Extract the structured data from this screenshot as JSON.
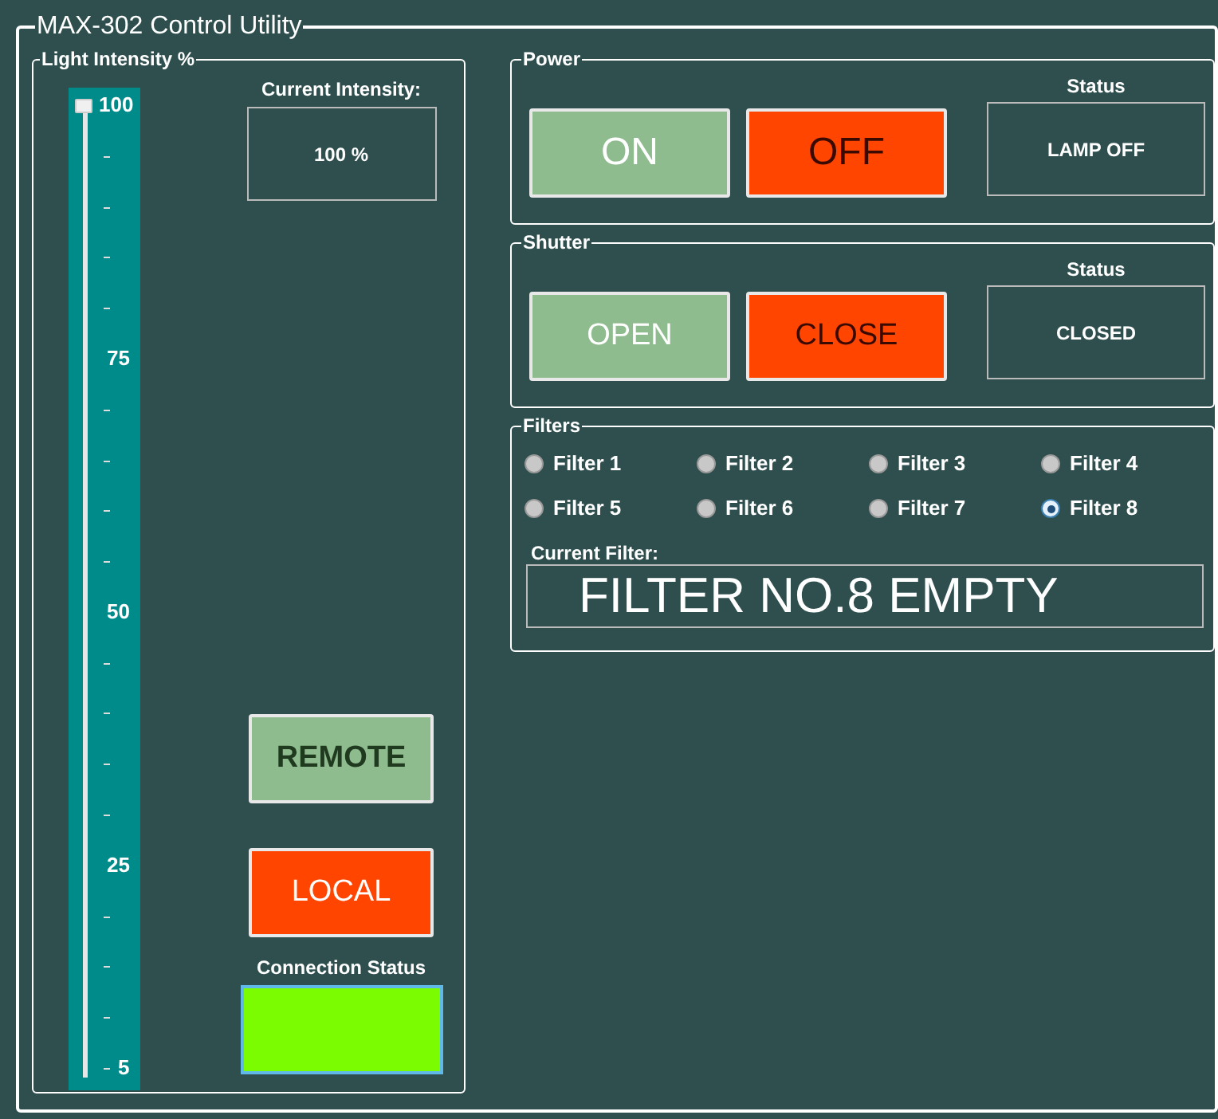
{
  "window": {
    "title": "MAX-302 Control Utility"
  },
  "intensity": {
    "title": "Light Intensity %",
    "level": 1,
    "scale_labels": [
      "100",
      "75",
      "50",
      "25",
      "5"
    ],
    "current_label": "Current Intensity:",
    "current_value": "100 %",
    "mode_buttons": [
      {
        "label": "REMOTE",
        "color": "#8fbc8f"
      },
      {
        "label": "LOCAL",
        "color": "#ff4500"
      }
    ],
    "connection": {
      "label": "Connection Status",
      "color": "#7cfc00"
    }
  },
  "power": {
    "title": "Power",
    "buttons": [
      {
        "label": "ON",
        "color": "#8fbc8f"
      },
      {
        "label": "OFF",
        "color": "#ff4500"
      }
    ],
    "status_label": "Status",
    "status": "LAMP OFF"
  },
  "shutter": {
    "title": "Shutter",
    "buttons": [
      {
        "label": "OPEN",
        "color": "#8fbc8f"
      },
      {
        "label": "CLOSE",
        "color": "#ff4500"
      }
    ],
    "status_label": "Status",
    "status": "CLOSED"
  },
  "filters": {
    "title": "Filters",
    "options": [
      {
        "label": "Filter 1",
        "selected": false
      },
      {
        "label": "Filter 2",
        "selected": false
      },
      {
        "label": "Filter 3",
        "selected": false
      },
      {
        "label": "Filter 4",
        "selected": false
      },
      {
        "label": "Filter 5",
        "selected": false
      },
      {
        "label": "Filter 6",
        "selected": false
      },
      {
        "label": "Filter 7",
        "selected": false
      },
      {
        "label": "Filter 8",
        "selected": true
      }
    ],
    "current_label": "Current Filter:",
    "current_value": "FILTER NO.8 EMPTY"
  }
}
